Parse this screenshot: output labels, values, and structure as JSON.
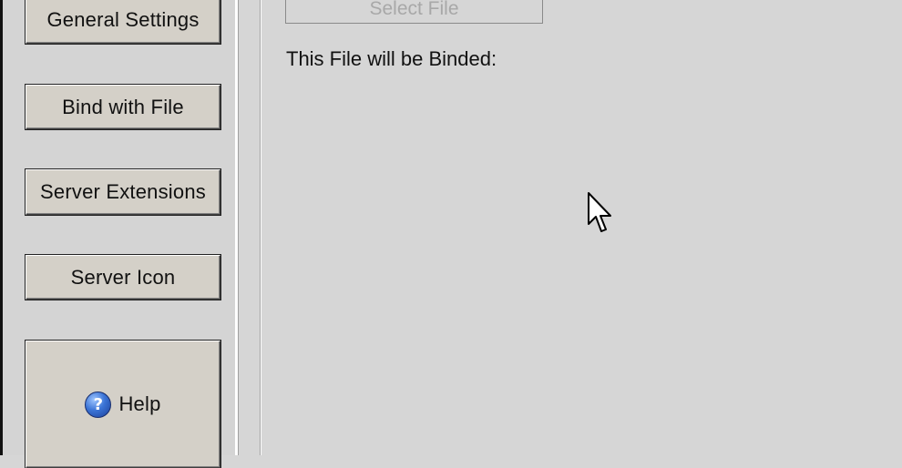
{
  "sidebar": {
    "buttons": [
      {
        "label": "General Settings"
      },
      {
        "label": "Bind with File"
      },
      {
        "label": "Server Extensions"
      },
      {
        "label": "Server Icon"
      }
    ],
    "help_button": {
      "label": "Help",
      "icon": "help-icon"
    }
  },
  "main": {
    "select_file_label": "Select File",
    "bind_label": "This File will be Binded:"
  },
  "colors": {
    "background": "#d6d6d6",
    "button_face": "#d4d0c8",
    "disabled_text": "#a8a8a8",
    "help_icon_blue": "#3b74d6"
  }
}
